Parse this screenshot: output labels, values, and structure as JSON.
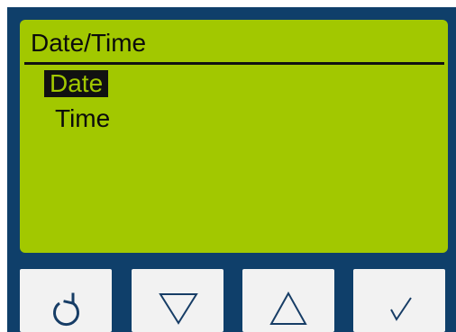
{
  "screen": {
    "title": "Date/Time",
    "menu": [
      {
        "label": "Date",
        "selected": true
      },
      {
        "label": "Time",
        "selected": false
      }
    ]
  },
  "softkeys": [
    {
      "icon": "back-rotate-icon"
    },
    {
      "icon": "down-triangle-icon"
    },
    {
      "icon": "up-triangle-icon"
    },
    {
      "icon": "check-icon"
    }
  ],
  "colors": {
    "bezel": "#0f3f6a",
    "lcd_background": "#a2c800",
    "lcd_text": "#0b0b0b",
    "key_face": "#f2f2f2"
  }
}
